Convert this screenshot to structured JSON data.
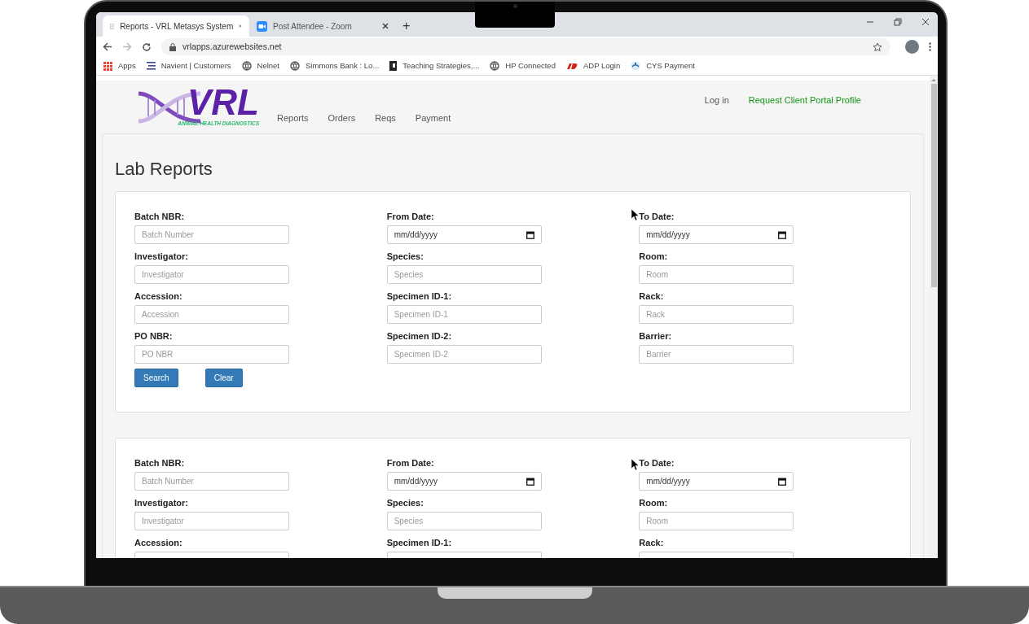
{
  "browser": {
    "tabs": [
      {
        "title": "Reports - VRL Metasys System",
        "selected": true
      },
      {
        "title": "Post Attendee - Zoom",
        "selected": false
      }
    ],
    "new_tab": "+",
    "address": "vrlapps.azurewebsites.net",
    "bookmarks": [
      {
        "label": "Apps"
      },
      {
        "label": "Navient | Customers"
      },
      {
        "label": "Nelnet"
      },
      {
        "label": "Simmons Bank : Lo..."
      },
      {
        "label": "Teaching Strategies,..."
      },
      {
        "label": "HP Connected"
      },
      {
        "label": "ADP Login"
      },
      {
        "label": "CYS Payment"
      }
    ]
  },
  "site": {
    "logo": {
      "wordmark": "VRL",
      "tagline": "ANIMAL HEALTH DIAGNOSTICS"
    },
    "nav": [
      {
        "label": "Reports"
      },
      {
        "label": "Orders"
      },
      {
        "label": "Reqs"
      },
      {
        "label": "Payment"
      }
    ],
    "account_links": [
      {
        "label": "Log in",
        "kind": "plain"
      },
      {
        "label": "Request Client Portal Profile",
        "kind": "accent"
      }
    ]
  },
  "page_title": "Lab Reports",
  "forms": [
    {
      "columns": [
        [
          {
            "label": "Batch NBR:",
            "kind": "text",
            "placeholder": "Batch Number"
          },
          {
            "label": "Investigator:",
            "kind": "text",
            "placeholder": "Investigator"
          },
          {
            "label": "Accession:",
            "kind": "text",
            "placeholder": "Accession"
          },
          {
            "label": "PO NBR:",
            "kind": "text",
            "placeholder": "PO NBR"
          }
        ],
        [
          {
            "label": "From Date:",
            "kind": "date",
            "placeholder": "mm/dd/yyyy"
          },
          {
            "label": "Species:",
            "kind": "text",
            "placeholder": "Species"
          },
          {
            "label": "Specimen ID-1:",
            "kind": "text",
            "placeholder": "Specimen ID-1"
          },
          {
            "label": "Specimen ID-2:",
            "kind": "text",
            "placeholder": "Specimen ID-2"
          }
        ],
        [
          {
            "label": "To Date:",
            "kind": "date",
            "placeholder": "mm/dd/yyyy"
          },
          {
            "label": "Room:",
            "kind": "text",
            "placeholder": "Room"
          },
          {
            "label": "Rack:",
            "kind": "text",
            "placeholder": "Rack"
          },
          {
            "label": "Barrier:",
            "kind": "text",
            "placeholder": "Barrier"
          }
        ]
      ],
      "buttons": [
        {
          "label": "Search"
        },
        {
          "label": "Clear"
        }
      ]
    },
    {
      "columns": [
        [
          {
            "label": "Batch NBR:",
            "kind": "text",
            "placeholder": "Batch Number"
          },
          {
            "label": "Investigator:",
            "kind": "text",
            "placeholder": "Investigator"
          },
          {
            "label": "Accession:",
            "kind": "text"
          }
        ],
        [
          {
            "label": "From Date:",
            "kind": "date",
            "placeholder": "mm/dd/yyyy"
          },
          {
            "label": "Species:",
            "kind": "text",
            "placeholder": "Species"
          },
          {
            "label": "Specimen ID-1:",
            "kind": "text"
          }
        ],
        [
          {
            "label": "To Date:",
            "kind": "date",
            "placeholder": "mm/dd/yyyy"
          },
          {
            "label": "Room:",
            "kind": "text",
            "placeholder": "Room"
          },
          {
            "label": "Rack:",
            "kind": "text"
          }
        ]
      ]
    }
  ]
}
